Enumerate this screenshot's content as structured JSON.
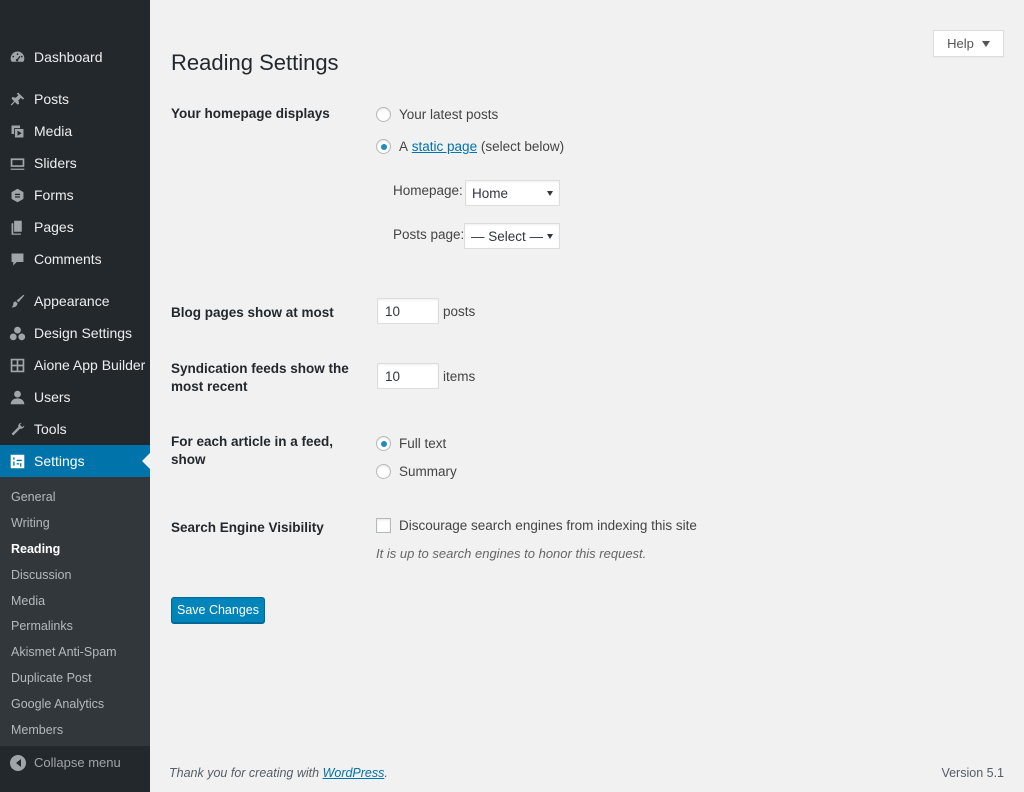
{
  "sidebar": {
    "menu": [
      {
        "label": "Dashboard",
        "icon": "dashboard-icon"
      },
      {
        "label": "Posts",
        "icon": "pin-icon"
      },
      {
        "label": "Media",
        "icon": "media-icon"
      },
      {
        "label": "Sliders",
        "icon": "slider-icon"
      },
      {
        "label": "Forms",
        "icon": "forms-icon"
      },
      {
        "label": "Pages",
        "icon": "pages-icon"
      },
      {
        "label": "Comments",
        "icon": "comment-icon"
      },
      {
        "label": "Appearance",
        "icon": "brush-icon"
      },
      {
        "label": "Design Settings",
        "icon": "palette-icon"
      },
      {
        "label": "Aione App Builder",
        "icon": "grid-icon"
      },
      {
        "label": "Users",
        "icon": "user-icon"
      },
      {
        "label": "Tools",
        "icon": "wrench-icon"
      },
      {
        "label": "Settings",
        "icon": "settings-icon"
      }
    ],
    "submenu": [
      "General",
      "Writing",
      "Reading",
      "Discussion",
      "Media",
      "Permalinks",
      "Akismet Anti-Spam",
      "Duplicate Post",
      "Google Analytics",
      "Members"
    ],
    "current_submenu": "Reading",
    "collapse_label": "Collapse menu"
  },
  "header": {
    "help_label": "Help",
    "title": "Reading Settings"
  },
  "homepage": {
    "label": "Your homepage displays",
    "option_latest": "Your latest posts",
    "option_static_prefix": "A",
    "option_static_link": "static page",
    "option_static_suffix": "(select below)",
    "selected": "static",
    "homepage_label": "Homepage:",
    "homepage_value": "Home",
    "posts_page_label": "Posts page:",
    "posts_page_value": "— Select —"
  },
  "blog_pages": {
    "label": "Blog pages show at most",
    "value": "10",
    "unit": "posts"
  },
  "syndication": {
    "label": "Syndication feeds show the most recent",
    "value": "10",
    "unit": "items"
  },
  "feed_article": {
    "label": "For each article in a feed, show",
    "option_full": "Full text",
    "option_summary": "Summary",
    "selected": "full"
  },
  "search_engine": {
    "label": "Search Engine Visibility",
    "checkbox_label": "Discourage search engines from indexing this site",
    "checked": false,
    "description": "It is up to search engines to honor this request."
  },
  "save_label": "Save Changes",
  "footer": {
    "thanks_prefix": "Thank you for creating with",
    "thanks_link": "WordPress",
    "thanks_suffix": ".",
    "version": "Version 5.1"
  },
  "colors": {
    "sidebar_bg": "#23282d",
    "submenu_bg": "#32373c",
    "accent": "#0073aa",
    "button": "#0085ba",
    "page_bg": "#f1f1f1"
  }
}
